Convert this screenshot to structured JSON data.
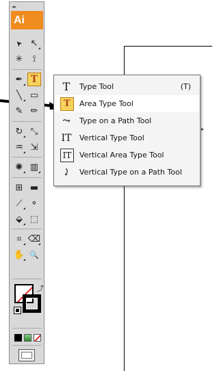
{
  "app": {
    "logo_text": "Ai"
  },
  "toolbar": {
    "grip_glyph": "◂▸",
    "tools": {
      "selection": "➤",
      "direct_selection": "↖",
      "magic_wand": "✳",
      "lasso": "⟟",
      "pen": "✒",
      "type": "T",
      "line": "╲",
      "rectangle": "▭",
      "paintbrush": "✎",
      "pencil": "✏",
      "rotate": "↻",
      "scale": "⤡",
      "warp": "♒",
      "free_transform": "⇲",
      "symbol_sprayer": "✺",
      "column_graph": "▥",
      "mesh": "⊞",
      "gradient": "▬",
      "eyedropper": "⟋",
      "blend": "⚬",
      "live_paint": "⬙",
      "live_paint_selection": "⬚",
      "slice": "⌗",
      "eraser": "⌫",
      "hand": "✋",
      "zoom": "🔍"
    },
    "swap_glyph": "⤴"
  },
  "flyout": {
    "items": [
      {
        "icon": "T",
        "label": "Type Tool",
        "shortcut": "(T)"
      },
      {
        "icon": "T",
        "label": "Area Type Tool",
        "shortcut": ""
      },
      {
        "icon": "⤳",
        "label": "Type on a Path Tool",
        "shortcut": ""
      },
      {
        "icon": "IT",
        "label": "Vertical Type Tool",
        "shortcut": ""
      },
      {
        "icon": "IT",
        "label": "Vertical Area Type Tool",
        "shortcut": ""
      },
      {
        "icon": "⤸",
        "label": "Vertical Type on a Path Tool",
        "shortcut": ""
      }
    ],
    "edge_glyph": "▸"
  },
  "colors": {
    "logo_bg": "#f08b1d",
    "selected_tool_bg": "#f6d35c",
    "none_slash": "#e0262a"
  }
}
